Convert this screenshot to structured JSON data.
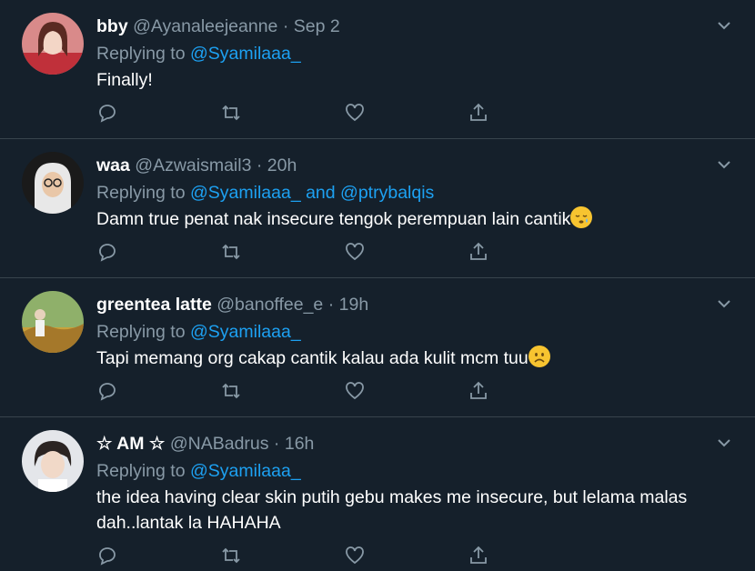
{
  "tweets": [
    {
      "name": "bby",
      "handle": "@Ayanaleejeanne",
      "sep": " · ",
      "time": "Sep 2",
      "replying_prefix": "Replying to ",
      "mentions": [
        "@Syamilaaa_"
      ],
      "mention_joiner": "",
      "text": "Finally!",
      "emoji": ""
    },
    {
      "name": "waa",
      "handle": "@Azwaismail3",
      "sep": " · ",
      "time": "20h",
      "replying_prefix": "Replying to ",
      "mentions": [
        "@Syamilaaa_",
        "@ptrybalqis"
      ],
      "mention_joiner": " and ",
      "text": "Damn true penat nak insecure tengok perempuan lain cantik",
      "emoji": "sleepy-face"
    },
    {
      "name": "greentea latte",
      "handle": "@banoffee_e",
      "sep": " · ",
      "time": "19h",
      "replying_prefix": "Replying to ",
      "mentions": [
        "@Syamilaaa_"
      ],
      "mention_joiner": "",
      "text": "Tapi memang org cakap cantik kalau ada kulit mcm tuu",
      "emoji": "frowning-face"
    },
    {
      "name": "☆ AM ☆",
      "handle": "@NABadrus",
      "sep": " · ",
      "time": "16h",
      "replying_prefix": "Replying to ",
      "mentions": [
        "@Syamilaaa_"
      ],
      "mention_joiner": "",
      "text": "the idea having clear skin putih gebu makes me insecure, but lelama malas dah..lantak la HAHAHA",
      "emoji": ""
    }
  ],
  "icons": {
    "reply": "reply-icon",
    "retweet": "retweet-icon",
    "like": "like-icon",
    "share": "share-icon",
    "more": "chevron-down-icon"
  },
  "colors": {
    "background": "#15202b",
    "divider": "#38444d",
    "secondary_text": "#8899a6",
    "link": "#1da1f2"
  }
}
